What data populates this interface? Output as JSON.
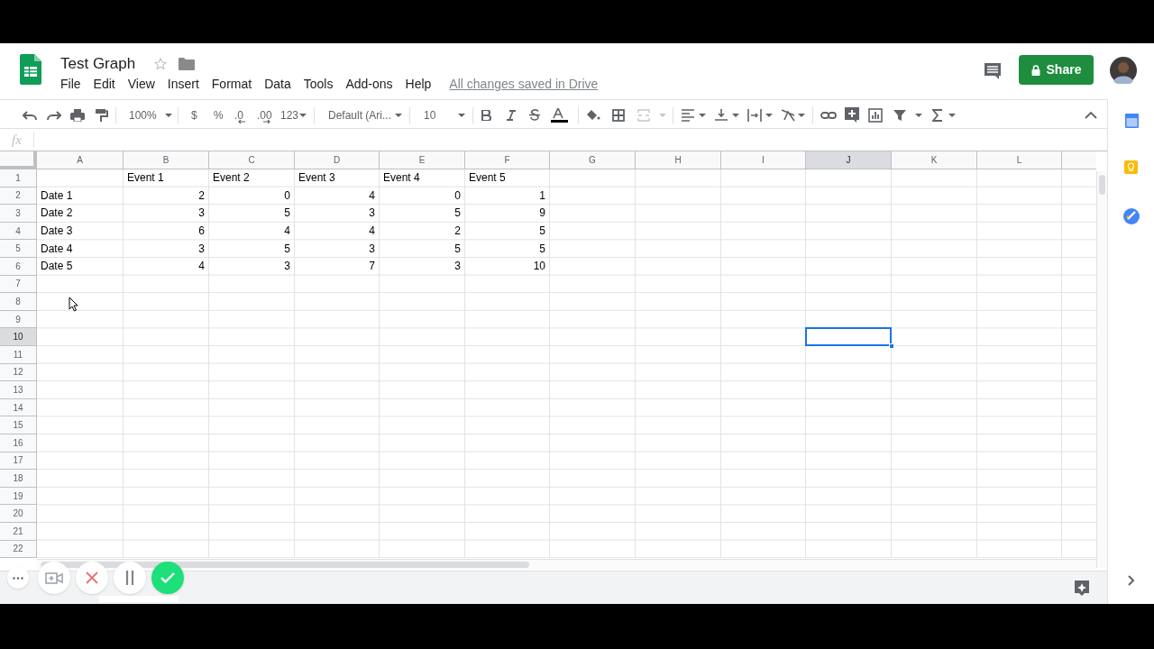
{
  "document": {
    "title": "Test Graph",
    "save_status": "All changes saved in Drive"
  },
  "menu": [
    "File",
    "Edit",
    "View",
    "Insert",
    "Format",
    "Data",
    "Tools",
    "Add-ons",
    "Help"
  ],
  "share_button": "Share",
  "toolbar": {
    "zoom": "100%",
    "currency": "$",
    "percent": "%",
    "decrease_decimal": ".0",
    "increase_decimal": ".00",
    "more_formats": "123",
    "font": "Default (Ari...",
    "font_size": "10"
  },
  "formula_bar": {
    "label": "fx"
  },
  "columns": [
    {
      "label": "A",
      "selected": false
    },
    {
      "label": "B",
      "selected": false
    },
    {
      "label": "C",
      "selected": false
    },
    {
      "label": "D",
      "selected": false
    },
    {
      "label": "E",
      "selected": false
    },
    {
      "label": "F",
      "selected": false
    },
    {
      "label": "G",
      "selected": false
    },
    {
      "label": "H",
      "selected": false
    },
    {
      "label": "I",
      "selected": false
    },
    {
      "label": "J",
      "selected": true
    },
    {
      "label": "K",
      "selected": false
    },
    {
      "label": "L",
      "selected": false
    }
  ],
  "rows": [
    {
      "number": "1",
      "selected": false
    },
    {
      "number": "2",
      "selected": false
    },
    {
      "number": "3",
      "selected": false
    },
    {
      "number": "4",
      "selected": false
    },
    {
      "number": "5",
      "selected": false
    },
    {
      "number": "6",
      "selected": false
    },
    {
      "number": "7",
      "selected": false
    },
    {
      "number": "8",
      "selected": false
    },
    {
      "number": "9",
      "selected": false
    },
    {
      "number": "10",
      "selected": true
    },
    {
      "number": "11",
      "selected": false
    },
    {
      "number": "12",
      "selected": false
    },
    {
      "number": "13",
      "selected": false
    },
    {
      "number": "14",
      "selected": false
    },
    {
      "number": "15",
      "selected": false
    },
    {
      "number": "16",
      "selected": false
    },
    {
      "number": "17",
      "selected": false
    },
    {
      "number": "18",
      "selected": false
    },
    {
      "number": "19",
      "selected": false
    },
    {
      "number": "20",
      "selected": false
    },
    {
      "number": "21",
      "selected": false
    },
    {
      "number": "22",
      "selected": false
    }
  ],
  "header_row": [
    "Event 1",
    "Event 2",
    "Event 3",
    "Event 4",
    "Event 5"
  ],
  "data_rows": [
    {
      "label": "Date 1",
      "values": [
        "2",
        "0",
        "4",
        "0",
        "1"
      ]
    },
    {
      "label": "Date 2",
      "values": [
        "3",
        "5",
        "3",
        "5",
        "9"
      ]
    },
    {
      "label": "Date 3",
      "values": [
        "6",
        "4",
        "4",
        "2",
        "5"
      ]
    },
    {
      "label": "Date 4",
      "values": [
        "3",
        "5",
        "3",
        "5",
        "5"
      ]
    },
    {
      "label": "Date 5",
      "values": [
        "4",
        "3",
        "7",
        "3",
        "10"
      ]
    }
  ]
}
